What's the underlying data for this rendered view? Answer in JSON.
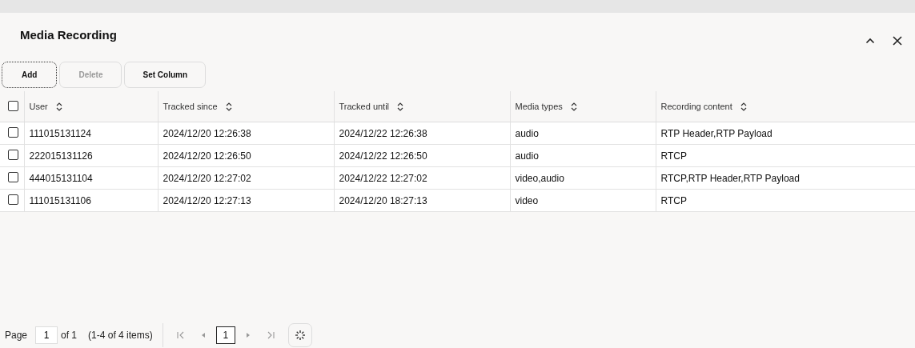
{
  "dialog": {
    "title": "Media Recording"
  },
  "toolbar": [
    {
      "label": "Add",
      "focused": true,
      "disabled": false
    },
    {
      "label": "Delete",
      "focused": false,
      "disabled": true
    },
    {
      "label": "Set Column",
      "focused": false,
      "disabled": false
    }
  ],
  "table": {
    "select_all": {
      "checked": false
    },
    "columns": [
      "User",
      "Tracked since",
      "Tracked until",
      "Media types",
      "Recording content"
    ],
    "rows": [
      {
        "checked": false,
        "cells": [
          "111015131124",
          "2024/12/20 12:26:38",
          "2024/12/22 12:26:38",
          "audio",
          "RTP Header,RTP Payload"
        ]
      },
      {
        "checked": false,
        "cells": [
          "222015131126",
          "2024/12/20 12:26:50",
          "2024/12/22 12:26:50",
          "audio",
          "RTCP"
        ]
      },
      {
        "checked": false,
        "cells": [
          "444015131104",
          "2024/12/20 12:27:02",
          "2024/12/22 12:27:02",
          "video,audio",
          "RTCP,RTP Header,RTP Payload"
        ]
      },
      {
        "checked": false,
        "cells": [
          "111015131106",
          "2024/12/20 12:27:13",
          "2024/12/20 18:27:13",
          "video",
          "RTCP"
        ]
      }
    ]
  },
  "pager": {
    "page_label": "Page",
    "page_value": "1",
    "of_label": "of 1",
    "summary": "(1-4 of 4 items)",
    "nav": [
      {
        "kind": "first",
        "disabled": true
      },
      {
        "kind": "prev",
        "disabled": true
      },
      {
        "kind": "page",
        "label": "1",
        "selected": true
      },
      {
        "kind": "next",
        "disabled": true
      },
      {
        "kind": "last",
        "disabled": true
      }
    ]
  }
}
